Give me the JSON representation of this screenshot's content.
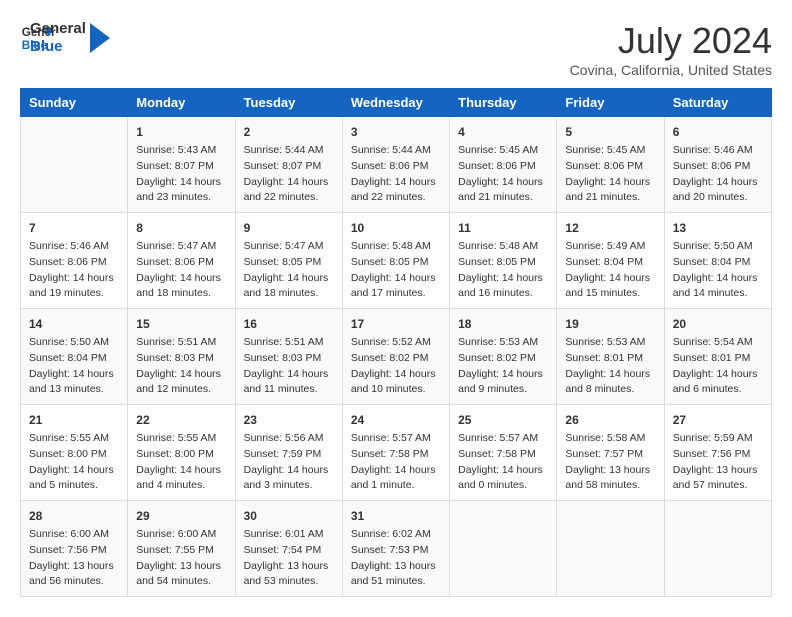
{
  "header": {
    "logo_general": "General",
    "logo_blue": "Blue",
    "month_year": "July 2024",
    "location": "Covina, California, United States"
  },
  "weekdays": [
    "Sunday",
    "Monday",
    "Tuesday",
    "Wednesday",
    "Thursday",
    "Friday",
    "Saturday"
  ],
  "weeks": [
    [
      {
        "day": "",
        "content": ""
      },
      {
        "day": "1",
        "content": "Sunrise: 5:43 AM\nSunset: 8:07 PM\nDaylight: 14 hours\nand 23 minutes."
      },
      {
        "day": "2",
        "content": "Sunrise: 5:44 AM\nSunset: 8:07 PM\nDaylight: 14 hours\nand 22 minutes."
      },
      {
        "day": "3",
        "content": "Sunrise: 5:44 AM\nSunset: 8:06 PM\nDaylight: 14 hours\nand 22 minutes."
      },
      {
        "day": "4",
        "content": "Sunrise: 5:45 AM\nSunset: 8:06 PM\nDaylight: 14 hours\nand 21 minutes."
      },
      {
        "day": "5",
        "content": "Sunrise: 5:45 AM\nSunset: 8:06 PM\nDaylight: 14 hours\nand 21 minutes."
      },
      {
        "day": "6",
        "content": "Sunrise: 5:46 AM\nSunset: 8:06 PM\nDaylight: 14 hours\nand 20 minutes."
      }
    ],
    [
      {
        "day": "7",
        "content": "Sunrise: 5:46 AM\nSunset: 8:06 PM\nDaylight: 14 hours\nand 19 minutes."
      },
      {
        "day": "8",
        "content": "Sunrise: 5:47 AM\nSunset: 8:06 PM\nDaylight: 14 hours\nand 18 minutes."
      },
      {
        "day": "9",
        "content": "Sunrise: 5:47 AM\nSunset: 8:05 PM\nDaylight: 14 hours\nand 18 minutes."
      },
      {
        "day": "10",
        "content": "Sunrise: 5:48 AM\nSunset: 8:05 PM\nDaylight: 14 hours\nand 17 minutes."
      },
      {
        "day": "11",
        "content": "Sunrise: 5:48 AM\nSunset: 8:05 PM\nDaylight: 14 hours\nand 16 minutes."
      },
      {
        "day": "12",
        "content": "Sunrise: 5:49 AM\nSunset: 8:04 PM\nDaylight: 14 hours\nand 15 minutes."
      },
      {
        "day": "13",
        "content": "Sunrise: 5:50 AM\nSunset: 8:04 PM\nDaylight: 14 hours\nand 14 minutes."
      }
    ],
    [
      {
        "day": "14",
        "content": "Sunrise: 5:50 AM\nSunset: 8:04 PM\nDaylight: 14 hours\nand 13 minutes."
      },
      {
        "day": "15",
        "content": "Sunrise: 5:51 AM\nSunset: 8:03 PM\nDaylight: 14 hours\nand 12 minutes."
      },
      {
        "day": "16",
        "content": "Sunrise: 5:51 AM\nSunset: 8:03 PM\nDaylight: 14 hours\nand 11 minutes."
      },
      {
        "day": "17",
        "content": "Sunrise: 5:52 AM\nSunset: 8:02 PM\nDaylight: 14 hours\nand 10 minutes."
      },
      {
        "day": "18",
        "content": "Sunrise: 5:53 AM\nSunset: 8:02 PM\nDaylight: 14 hours\nand 9 minutes."
      },
      {
        "day": "19",
        "content": "Sunrise: 5:53 AM\nSunset: 8:01 PM\nDaylight: 14 hours\nand 8 minutes."
      },
      {
        "day": "20",
        "content": "Sunrise: 5:54 AM\nSunset: 8:01 PM\nDaylight: 14 hours\nand 6 minutes."
      }
    ],
    [
      {
        "day": "21",
        "content": "Sunrise: 5:55 AM\nSunset: 8:00 PM\nDaylight: 14 hours\nand 5 minutes."
      },
      {
        "day": "22",
        "content": "Sunrise: 5:55 AM\nSunset: 8:00 PM\nDaylight: 14 hours\nand 4 minutes."
      },
      {
        "day": "23",
        "content": "Sunrise: 5:56 AM\nSunset: 7:59 PM\nDaylight: 14 hours\nand 3 minutes."
      },
      {
        "day": "24",
        "content": "Sunrise: 5:57 AM\nSunset: 7:58 PM\nDaylight: 14 hours\nand 1 minute."
      },
      {
        "day": "25",
        "content": "Sunrise: 5:57 AM\nSunset: 7:58 PM\nDaylight: 14 hours\nand 0 minutes."
      },
      {
        "day": "26",
        "content": "Sunrise: 5:58 AM\nSunset: 7:57 PM\nDaylight: 13 hours\nand 58 minutes."
      },
      {
        "day": "27",
        "content": "Sunrise: 5:59 AM\nSunset: 7:56 PM\nDaylight: 13 hours\nand 57 minutes."
      }
    ],
    [
      {
        "day": "28",
        "content": "Sunrise: 6:00 AM\nSunset: 7:56 PM\nDaylight: 13 hours\nand 56 minutes."
      },
      {
        "day": "29",
        "content": "Sunrise: 6:00 AM\nSunset: 7:55 PM\nDaylight: 13 hours\nand 54 minutes."
      },
      {
        "day": "30",
        "content": "Sunrise: 6:01 AM\nSunset: 7:54 PM\nDaylight: 13 hours\nand 53 minutes."
      },
      {
        "day": "31",
        "content": "Sunrise: 6:02 AM\nSunset: 7:53 PM\nDaylight: 13 hours\nand 51 minutes."
      },
      {
        "day": "",
        "content": ""
      },
      {
        "day": "",
        "content": ""
      },
      {
        "day": "",
        "content": ""
      }
    ]
  ]
}
